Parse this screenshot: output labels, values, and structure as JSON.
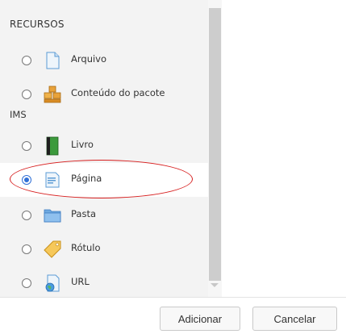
{
  "section_title": "RECURSOS",
  "items": [
    {
      "label": "Arquivo",
      "icon": "file-icon",
      "selected": false
    },
    {
      "label": "Conteúdo do pacote",
      "label_cont": "IMS",
      "icon": "ims-package-icon",
      "selected": false
    },
    {
      "label": "Livro",
      "icon": "book-icon",
      "selected": false
    },
    {
      "label": "Página",
      "icon": "page-icon",
      "selected": true
    },
    {
      "label": "Pasta",
      "icon": "folder-icon",
      "selected": false
    },
    {
      "label": "Rótulo",
      "icon": "label-tag-icon",
      "selected": false
    },
    {
      "label": "URL",
      "icon": "url-icon",
      "selected": false
    }
  ],
  "buttons": {
    "add_label": "Adicionar",
    "cancel_label": "Cancelar"
  },
  "colors": {
    "accent": "#2f6fd6",
    "highlight_ellipse": "#d71f1f"
  }
}
